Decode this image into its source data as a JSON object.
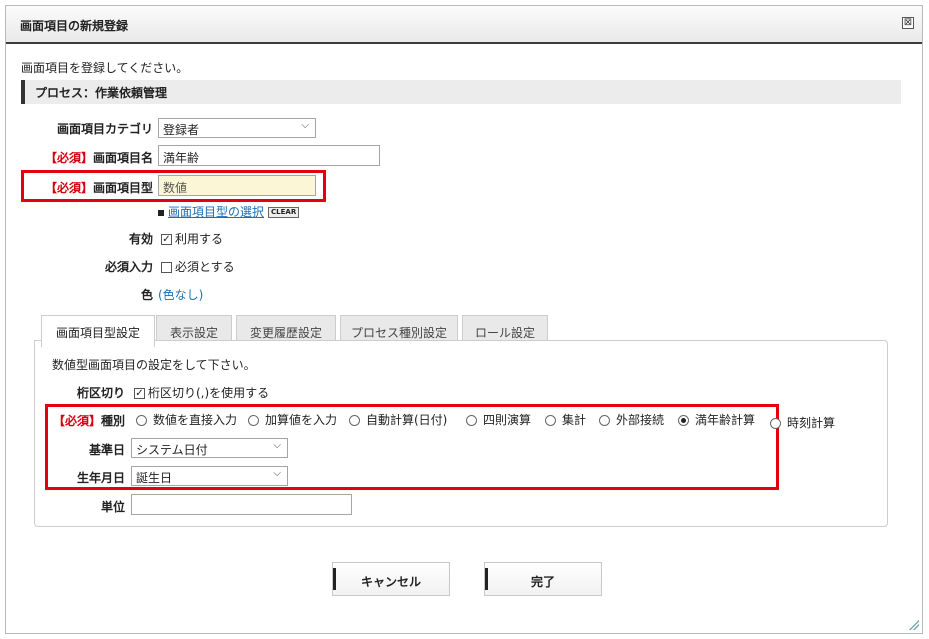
{
  "dialog": {
    "title": "画面項目の新規登録",
    "close_glyph": "⊠",
    "instruction": "画面項目を登録してください。",
    "process_label": "プロセス：作業依頼管理"
  },
  "form": {
    "category": {
      "label": "画面項目カテゴリ",
      "value": "登録者"
    },
    "required_tag": "【必須】",
    "name": {
      "label": "画面項目名",
      "value": "満年齢"
    },
    "type": {
      "label": "画面項目型",
      "value": "数値",
      "select_link": "画面項目型の選択",
      "clear_label": "CLEAR"
    },
    "enabled": {
      "label": "有効",
      "option": "利用する",
      "checked": true
    },
    "required_input": {
      "label": "必須入力",
      "option": "必須とする",
      "checked": false
    },
    "color": {
      "label": "色",
      "value": "(色なし)"
    }
  },
  "tabs": [
    {
      "label": "画面項目型設定",
      "active": true
    },
    {
      "label": "表示設定",
      "active": false
    },
    {
      "label": "変更履歴設定",
      "active": false
    },
    {
      "label": "プロセス種別設定",
      "active": false
    },
    {
      "label": "ロール設定",
      "active": false
    }
  ],
  "panel": {
    "description": "数値型画面項目の設定をして下さい。",
    "digit_sep": {
      "label": "桁区切り",
      "option": "桁区切り(,)を使用する",
      "checked": true
    },
    "kind": {
      "label": "種別",
      "options": [
        "数値を直接入力",
        "加算値を入力",
        "自動計算(日付)",
        "四則演算",
        "集計",
        "外部接続",
        "満年齢計算",
        "時刻計算"
      ],
      "selected": "満年齢計算"
    },
    "base_date": {
      "label": "基準日",
      "value": "システム日付"
    },
    "birth_date": {
      "label": "生年月日",
      "value": "誕生日"
    },
    "unit": {
      "label": "単位",
      "value": ""
    }
  },
  "buttons": {
    "cancel": "キャンセル",
    "done": "完了"
  },
  "colors": {
    "highlight": "#e4000f",
    "required": "#d6000f",
    "link": "#1a6fb5"
  }
}
